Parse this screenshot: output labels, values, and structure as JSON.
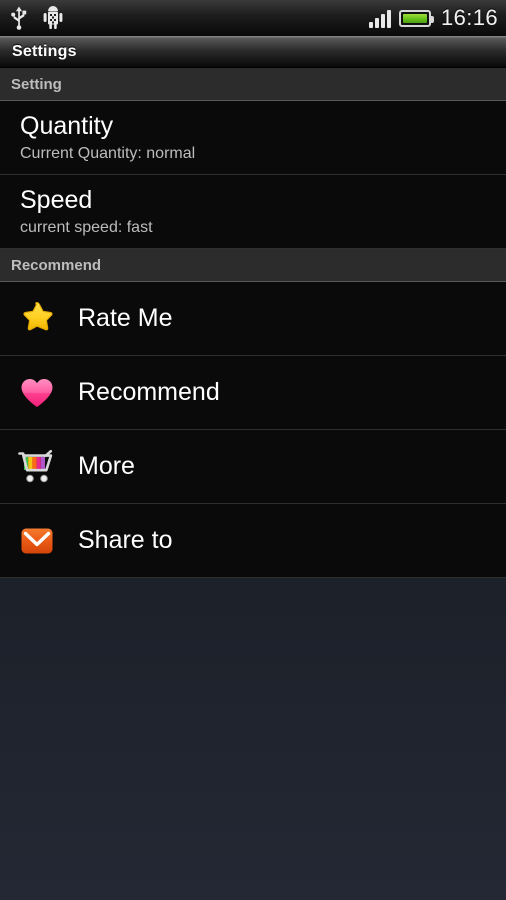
{
  "statusbar": {
    "left_icons": [
      "usb-icon",
      "android-debug-icon"
    ],
    "signal_bars": 4,
    "battery_icon": "battery-full-icon",
    "time": "16:16"
  },
  "titlebar": {
    "title": "Settings"
  },
  "sections": [
    {
      "header": "Setting",
      "rows": [
        {
          "title": "Quantity",
          "subtitle": "Current Quantity: normal"
        },
        {
          "title": "Speed",
          "subtitle": "current speed: fast"
        }
      ]
    },
    {
      "header": "Recommend",
      "rows": [
        {
          "title": "Rate Me",
          "icon": "star-icon"
        },
        {
          "title": "Recommend",
          "icon": "heart-icon"
        },
        {
          "title": "More",
          "icon": "shopping-cart-icon"
        },
        {
          "title": "Share to",
          "icon": "envelope-icon"
        }
      ]
    }
  ],
  "colors": {
    "star": "#FFD633",
    "heart": "#FF5A9E",
    "envelope": "#E8581C",
    "battery": "#6FC71B",
    "header_text": "#BDBDBD",
    "row_title": "#FFFFFF",
    "row_subtitle": "#BCBCBC"
  }
}
